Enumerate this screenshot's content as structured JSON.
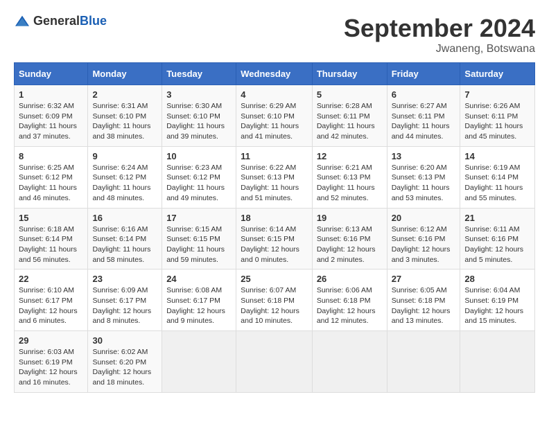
{
  "header": {
    "logo_general": "General",
    "logo_blue": "Blue",
    "title": "September 2024",
    "location": "Jwaneng, Botswana"
  },
  "calendar": {
    "days_of_week": [
      "Sunday",
      "Monday",
      "Tuesday",
      "Wednesday",
      "Thursday",
      "Friday",
      "Saturday"
    ],
    "weeks": [
      [
        null,
        null,
        null,
        null,
        null,
        null,
        null
      ]
    ],
    "cells": [
      {
        "day": "",
        "info": ""
      },
      {
        "day": "",
        "info": ""
      },
      {
        "day": "",
        "info": ""
      },
      {
        "day": "",
        "info": ""
      },
      {
        "day": "",
        "info": ""
      },
      {
        "day": "",
        "info": ""
      },
      {
        "day": "1",
        "sunrise": "Sunrise: 6:32 AM",
        "sunset": "Sunset: 6:09 PM",
        "daylight": "Daylight: 11 hours and 37 minutes."
      },
      {
        "day": "2",
        "sunrise": "Sunrise: 6:31 AM",
        "sunset": "Sunset: 6:10 PM",
        "daylight": "Daylight: 11 hours and 38 minutes."
      },
      {
        "day": "3",
        "sunrise": "Sunrise: 6:30 AM",
        "sunset": "Sunset: 6:10 PM",
        "daylight": "Daylight: 11 hours and 39 minutes."
      },
      {
        "day": "4",
        "sunrise": "Sunrise: 6:29 AM",
        "sunset": "Sunset: 6:10 PM",
        "daylight": "Daylight: 11 hours and 41 minutes."
      },
      {
        "day": "5",
        "sunrise": "Sunrise: 6:28 AM",
        "sunset": "Sunset: 6:11 PM",
        "daylight": "Daylight: 11 hours and 42 minutes."
      },
      {
        "day": "6",
        "sunrise": "Sunrise: 6:27 AM",
        "sunset": "Sunset: 6:11 PM",
        "daylight": "Daylight: 11 hours and 44 minutes."
      },
      {
        "day": "7",
        "sunrise": "Sunrise: 6:26 AM",
        "sunset": "Sunset: 6:11 PM",
        "daylight": "Daylight: 11 hours and 45 minutes."
      },
      {
        "day": "8",
        "sunrise": "Sunrise: 6:25 AM",
        "sunset": "Sunset: 6:12 PM",
        "daylight": "Daylight: 11 hours and 46 minutes."
      },
      {
        "day": "9",
        "sunrise": "Sunrise: 6:24 AM",
        "sunset": "Sunset: 6:12 PM",
        "daylight": "Daylight: 11 hours and 48 minutes."
      },
      {
        "day": "10",
        "sunrise": "Sunrise: 6:23 AM",
        "sunset": "Sunset: 6:12 PM",
        "daylight": "Daylight: 11 hours and 49 minutes."
      },
      {
        "day": "11",
        "sunrise": "Sunrise: 6:22 AM",
        "sunset": "Sunset: 6:13 PM",
        "daylight": "Daylight: 11 hours and 51 minutes."
      },
      {
        "day": "12",
        "sunrise": "Sunrise: 6:21 AM",
        "sunset": "Sunset: 6:13 PM",
        "daylight": "Daylight: 11 hours and 52 minutes."
      },
      {
        "day": "13",
        "sunrise": "Sunrise: 6:20 AM",
        "sunset": "Sunset: 6:13 PM",
        "daylight": "Daylight: 11 hours and 53 minutes."
      },
      {
        "day": "14",
        "sunrise": "Sunrise: 6:19 AM",
        "sunset": "Sunset: 6:14 PM",
        "daylight": "Daylight: 11 hours and 55 minutes."
      },
      {
        "day": "15",
        "sunrise": "Sunrise: 6:18 AM",
        "sunset": "Sunset: 6:14 PM",
        "daylight": "Daylight: 11 hours and 56 minutes."
      },
      {
        "day": "16",
        "sunrise": "Sunrise: 6:16 AM",
        "sunset": "Sunset: 6:14 PM",
        "daylight": "Daylight: 11 hours and 58 minutes."
      },
      {
        "day": "17",
        "sunrise": "Sunrise: 6:15 AM",
        "sunset": "Sunset: 6:15 PM",
        "daylight": "Daylight: 11 hours and 59 minutes."
      },
      {
        "day": "18",
        "sunrise": "Sunrise: 6:14 AM",
        "sunset": "Sunset: 6:15 PM",
        "daylight": "Daylight: 12 hours and 0 minutes."
      },
      {
        "day": "19",
        "sunrise": "Sunrise: 6:13 AM",
        "sunset": "Sunset: 6:16 PM",
        "daylight": "Daylight: 12 hours and 2 minutes."
      },
      {
        "day": "20",
        "sunrise": "Sunrise: 6:12 AM",
        "sunset": "Sunset: 6:16 PM",
        "daylight": "Daylight: 12 hours and 3 minutes."
      },
      {
        "day": "21",
        "sunrise": "Sunrise: 6:11 AM",
        "sunset": "Sunset: 6:16 PM",
        "daylight": "Daylight: 12 hours and 5 minutes."
      },
      {
        "day": "22",
        "sunrise": "Sunrise: 6:10 AM",
        "sunset": "Sunset: 6:17 PM",
        "daylight": "Daylight: 12 hours and 6 minutes."
      },
      {
        "day": "23",
        "sunrise": "Sunrise: 6:09 AM",
        "sunset": "Sunset: 6:17 PM",
        "daylight": "Daylight: 12 hours and 8 minutes."
      },
      {
        "day": "24",
        "sunrise": "Sunrise: 6:08 AM",
        "sunset": "Sunset: 6:17 PM",
        "daylight": "Daylight: 12 hours and 9 minutes."
      },
      {
        "day": "25",
        "sunrise": "Sunrise: 6:07 AM",
        "sunset": "Sunset: 6:18 PM",
        "daylight": "Daylight: 12 hours and 10 minutes."
      },
      {
        "day": "26",
        "sunrise": "Sunrise: 6:06 AM",
        "sunset": "Sunset: 6:18 PM",
        "daylight": "Daylight: 12 hours and 12 minutes."
      },
      {
        "day": "27",
        "sunrise": "Sunrise: 6:05 AM",
        "sunset": "Sunset: 6:18 PM",
        "daylight": "Daylight: 12 hours and 13 minutes."
      },
      {
        "day": "28",
        "sunrise": "Sunrise: 6:04 AM",
        "sunset": "Sunset: 6:19 PM",
        "daylight": "Daylight: 12 hours and 15 minutes."
      },
      {
        "day": "29",
        "sunrise": "Sunrise: 6:03 AM",
        "sunset": "Sunset: 6:19 PM",
        "daylight": "Daylight: 12 hours and 16 minutes."
      },
      {
        "day": "30",
        "sunrise": "Sunrise: 6:02 AM",
        "sunset": "Sunset: 6:20 PM",
        "daylight": "Daylight: 12 hours and 18 minutes."
      },
      {
        "day": "",
        "info": ""
      },
      {
        "day": "",
        "info": ""
      },
      {
        "day": "",
        "info": ""
      },
      {
        "day": "",
        "info": ""
      },
      {
        "day": "",
        "info": ""
      }
    ]
  }
}
